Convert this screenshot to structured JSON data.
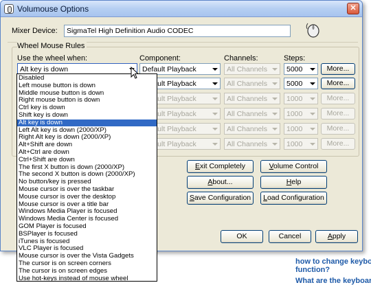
{
  "background": {
    "links": [
      "how to change keyboard",
      "function?",
      "What are the keyboard s"
    ]
  },
  "window": {
    "title": "Volumouse Options",
    "close_label": "✕"
  },
  "mixer": {
    "label": "Mixer Device:",
    "value": "SigmaTel High Definition Audio CODEC"
  },
  "rules": {
    "group_label": "Wheel Mouse Rules",
    "headers": {
      "wheel": "Use the wheel when:",
      "component": "Component:",
      "channels": "Channels:",
      "steps": "Steps:"
    },
    "rows": [
      {
        "wheel": "Alt key is down",
        "component": "Default Playback",
        "channels": "All Channels",
        "steps": "5000",
        "more": "More...",
        "enabled": true
      },
      {
        "wheel": "",
        "component": "Default Playback",
        "channels": "All Channels",
        "steps": "5000",
        "more": "More...",
        "enabled": true
      },
      {
        "wheel": "",
        "component": "Default Playback",
        "channels": "All Channels",
        "steps": "1000",
        "more": "More...",
        "enabled": false
      },
      {
        "wheel": "",
        "component": "Default Playback",
        "channels": "All Channels",
        "steps": "1000",
        "more": "More...",
        "enabled": false
      },
      {
        "wheel": "",
        "component": "Default Playback",
        "channels": "All Channels",
        "steps": "1000",
        "more": "More...",
        "enabled": false
      },
      {
        "wheel": "",
        "component": "Default Playback",
        "channels": "All Channels",
        "steps": "1000",
        "more": "More...",
        "enabled": false
      }
    ]
  },
  "dropdown": {
    "selected_index": 6,
    "options": [
      "Disabled",
      "Left mouse button is down",
      "Middle mouse button is down",
      "Right mouse button is down",
      "Ctrl key is down",
      "Shift key is down",
      "Alt key is down",
      "Left Alt key is down  (2000/XP)",
      "Right Alt key is down  (2000/XP)",
      "Alt+Shift are down",
      "Alt+Ctrl are down",
      "Ctrl+Shift are down",
      "The first X button is down  (2000/XP)",
      "The second X button is down  (2000/XP)",
      "No button/key is pressed",
      "Mouse cursor is over the taskbar",
      "Mouse cursor is over the desktop",
      "Mouse cursor is over a title bar",
      "Windows Media Player is focused",
      "Windows Media Center is focused",
      "GOM Player is focused",
      "BSPlayer is focused",
      "iTunes is focused",
      "VLC Player is focused",
      "Mouse cursor is over the Vista Gadgets",
      "The cursor is on screen corners",
      "The cursor is on screen edges",
      "Use hot-keys instead of mouse wheel"
    ]
  },
  "buttons": {
    "exit_u": "E",
    "exit_rest": "xit Completely",
    "volume_u": "V",
    "volume_rest": "olume Control",
    "about_u": "A",
    "about_rest": "bout...",
    "help_u": "H",
    "help_rest": "elp",
    "save_u": "S",
    "save_rest": "ave Configuration",
    "load_u": "L",
    "load_rest": "oad Configuration",
    "ok": "OK",
    "cancel": "Cancel",
    "apply_u": "A",
    "apply_rest": "pply"
  }
}
